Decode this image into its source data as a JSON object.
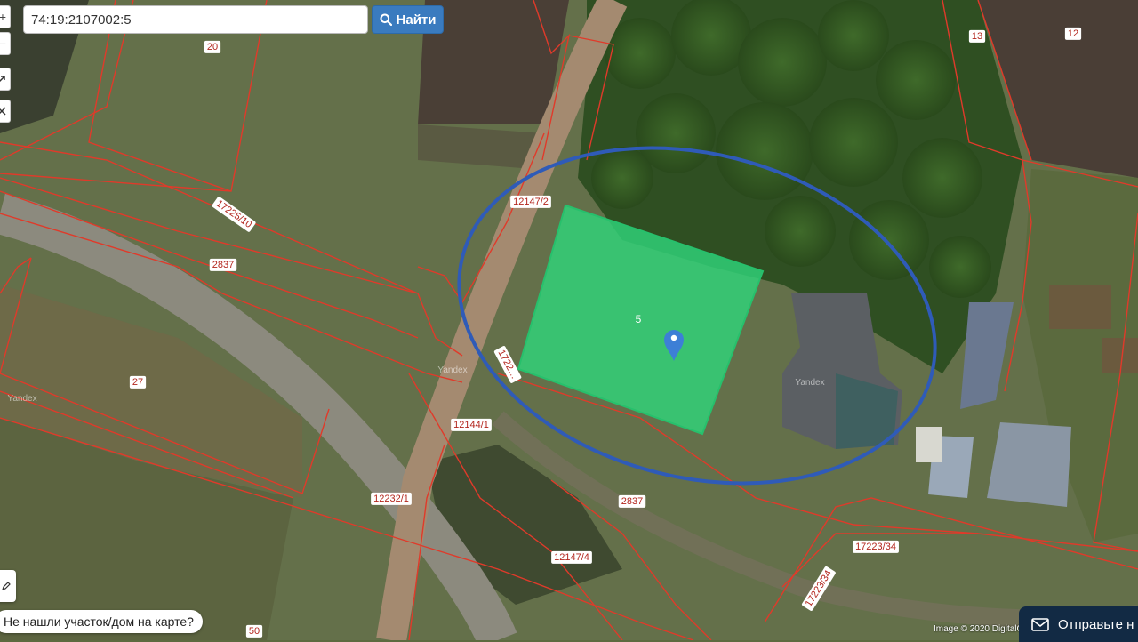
{
  "search": {
    "value": "74:19:2107002:5",
    "button_label": "Найти"
  },
  "zoom": {
    "in_label": "+",
    "out_label": "−"
  },
  "map": {
    "selected_parcel_label": "5",
    "parcel_labels": [
      "20",
      "13",
      "12",
      "17225/10",
      "2837",
      "27",
      "12147/2",
      "1722…",
      "12144/1",
      "12232/1",
      "2837",
      "12147/4",
      "17223/34",
      "17223/34",
      "50"
    ],
    "watermarks": [
      "Yandex",
      "Yandex",
      "Yandex"
    ],
    "colors": {
      "parcel_fill": "#2fd47a",
      "parcel_border": "#e03a2a",
      "highlight_ellipse": "#2f5bb8",
      "marker": "#3d7fd6"
    }
  },
  "bottom": {
    "question": "Не нашли участок/дом на карте?",
    "attribution": "Image © 2020 DigitalG",
    "send_label": "Отправьте н"
  }
}
